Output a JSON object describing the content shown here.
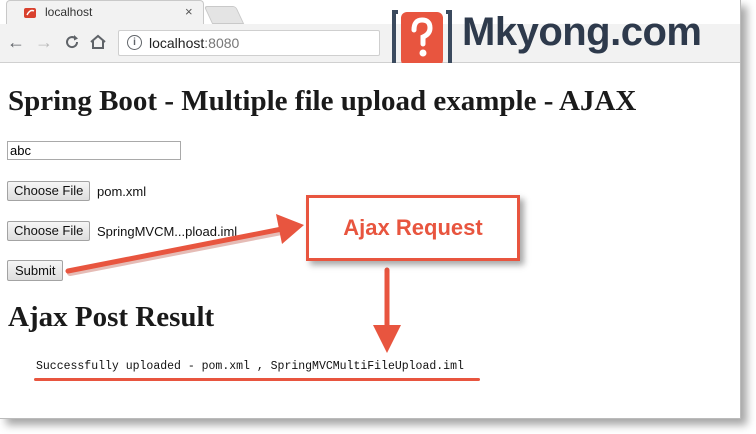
{
  "browser": {
    "tab_title": "localhost",
    "tab_close": "×",
    "url_host": "localhost",
    "url_port": ":8080",
    "info_icon": "i"
  },
  "logo": {
    "text": "Mkyong.com",
    "icon": "question-mark-box-icon"
  },
  "page": {
    "title": "Spring Boot - Multiple file upload example - AJAX",
    "extra_field_value": "abc",
    "file_inputs": [
      {
        "button_label": "Choose File",
        "file_name": "pom.xml"
      },
      {
        "button_label": "Choose File",
        "file_name": "SpringMVCM...pload.iml"
      }
    ],
    "submit_label": "Submit",
    "result_heading": "Ajax Post Result",
    "result_text": "Successfully uploaded - pom.xml , SpringMVCMultiFileUpload.iml"
  },
  "annotation": {
    "callout_text": "Ajax Request",
    "accent_color": "#e8553f"
  }
}
